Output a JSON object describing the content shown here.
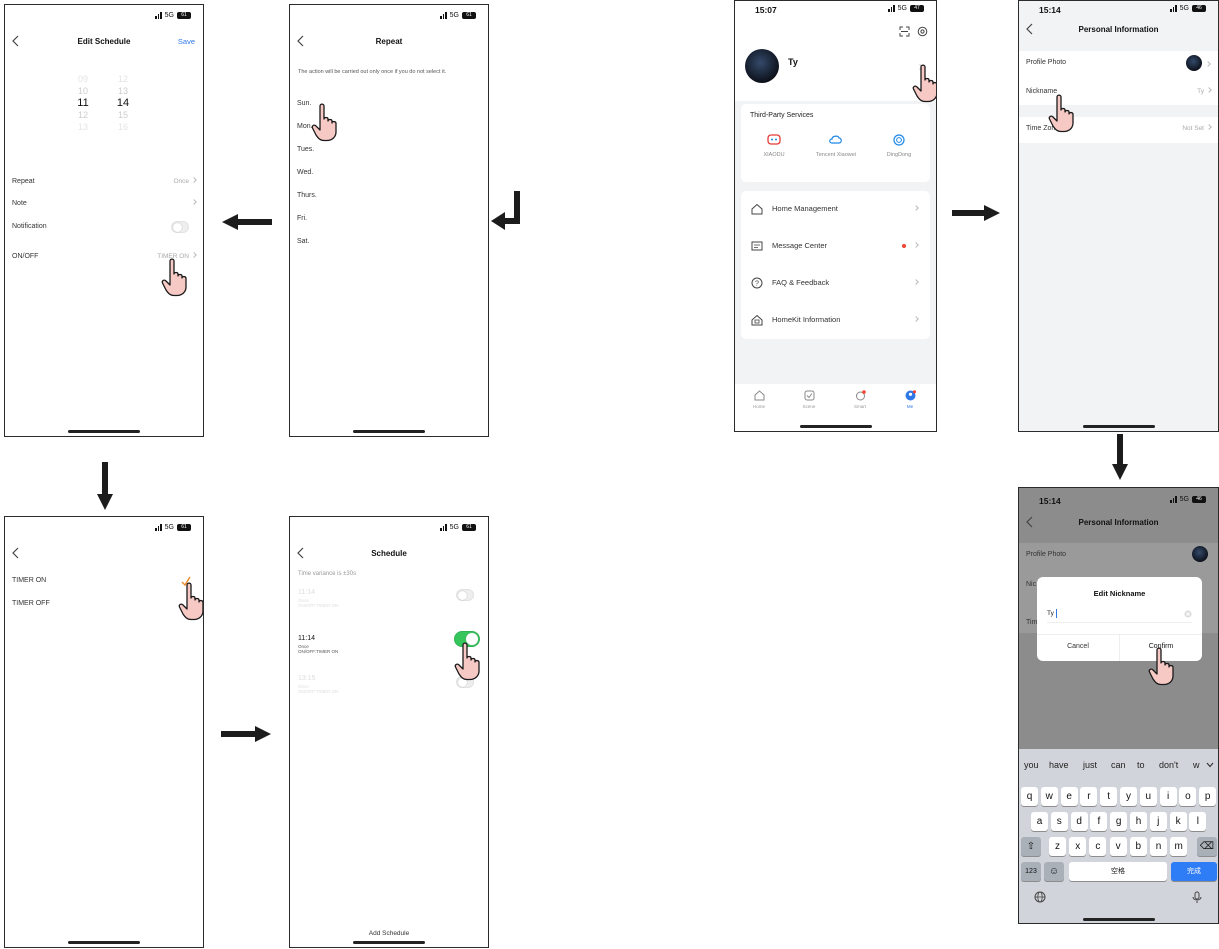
{
  "status": {
    "network": "5G",
    "battery_a": "61",
    "battery_b": "47",
    "battery_c": "46",
    "time_me": "15:07",
    "time_pi": "15:14"
  },
  "edit_schedule": {
    "title": "Edit Schedule",
    "save": "Save",
    "hours": [
      "09",
      "10",
      "11",
      "12",
      "13"
    ],
    "minutes": [
      "12",
      "13",
      "14",
      "15",
      "16"
    ],
    "rows": [
      {
        "label": "Repeat",
        "value": "Once"
      },
      {
        "label": "Note",
        "value": ""
      },
      {
        "label": "Notification",
        "value": ""
      },
      {
        "label": "ON/OFF",
        "value": "TIMER ON"
      }
    ]
  },
  "repeat": {
    "title": "Repeat",
    "hint": "The action will be carried out only once if you do not select it.",
    "days": [
      "Sun.",
      "Mon.",
      "Tues.",
      "Wed.",
      "Thurs.",
      "Fri.",
      "Sat."
    ]
  },
  "timer_select": {
    "options": [
      "TIMER ON",
      "TIMER OFF"
    ]
  },
  "schedule": {
    "title": "Schedule",
    "variance": "Time variance is ±30s",
    "items": [
      {
        "time": "11:14",
        "repeat": "Once",
        "action": "ON/OFF:TIMER ON",
        "enabled": false,
        "faded": true
      },
      {
        "time": "11:14",
        "repeat": "Once",
        "action": "ON/OFF:TIMER ON",
        "enabled": true,
        "faded": false
      },
      {
        "time": "13:15",
        "repeat": "Once",
        "action": "ON/OFF:TIMER ON",
        "enabled": false,
        "faded": true
      }
    ],
    "add_button": "Add Schedule"
  },
  "me": {
    "name": "Ty",
    "third_party_title": "Third-Party Services",
    "services": [
      {
        "label": "XIAODU",
        "icon": "xiaodu-icon",
        "color": "#e53935"
      },
      {
        "label": "Tencent Xiaowei",
        "icon": "tencent-xiaowei-icon",
        "color": "#1e88e5"
      },
      {
        "label": "DingDong",
        "icon": "dingdong-icon",
        "color": "#1e88e5"
      }
    ],
    "menu": [
      {
        "label": "Home Management",
        "icon": "house-icon"
      },
      {
        "label": "Message Center",
        "icon": "message-icon"
      },
      {
        "label": "FAQ & Feedback",
        "icon": "help-icon"
      },
      {
        "label": "HomeKit Information",
        "icon": "homekit-icon"
      }
    ],
    "tabs": [
      "Home",
      "Scene",
      "Smart",
      "Me"
    ]
  },
  "personal_info": {
    "title": "Personal Information",
    "rows": [
      {
        "label": "Profile Photo",
        "value": ""
      },
      {
        "label": "Nickname",
        "value": "Ty"
      },
      {
        "label": "Time Zone",
        "value": "Not Set"
      }
    ]
  },
  "edit_nickname": {
    "title": "Edit Nickname",
    "value": "Ty",
    "cancel": "Cancel",
    "confirm": "Confirm",
    "row_short_1": "Nic",
    "row_short_2": "Tim"
  },
  "keyboard": {
    "suggestions": [
      "you",
      "have",
      "just",
      "can",
      "to",
      "don't",
      "w"
    ],
    "row1": [
      "q",
      "w",
      "e",
      "r",
      "t",
      "y",
      "u",
      "i",
      "o",
      "p"
    ],
    "row2": [
      "a",
      "s",
      "d",
      "f",
      "g",
      "h",
      "j",
      "k",
      "l"
    ],
    "row3": [
      "z",
      "x",
      "c",
      "v",
      "b",
      "n",
      "m"
    ],
    "num_key": "123",
    "space": "空格",
    "done": "完成"
  }
}
